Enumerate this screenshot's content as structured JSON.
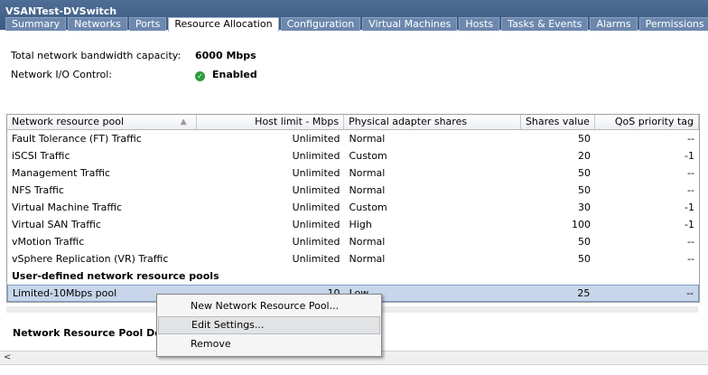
{
  "window": {
    "title": "VSANTest-DVSwitch"
  },
  "tabs": [
    "Summary",
    "Networks",
    "Ports",
    "Resource Allocation",
    "Configuration",
    "Virtual Machines",
    "Hosts",
    "Tasks & Events",
    "Alarms",
    "Permissions"
  ],
  "active_tab": "Resource Allocation",
  "info": {
    "bandwidth_label": "Total network bandwidth capacity:",
    "bandwidth_value": "6000 Mbps",
    "nioc_label": "Network I/O Control:",
    "nioc_value": "Enabled"
  },
  "table": {
    "columns": [
      "Network resource pool",
      "Host limit - Mbps",
      "Physical adapter shares",
      "Shares value",
      "QoS priority tag"
    ],
    "rows": [
      {
        "pool": "Fault Tolerance (FT) Traffic",
        "limit": "Unlimited",
        "shares": "Normal",
        "value": "50",
        "qos": "--"
      },
      {
        "pool": "iSCSI Traffic",
        "limit": "Unlimited",
        "shares": "Custom",
        "value": "20",
        "qos": "-1"
      },
      {
        "pool": "Management Traffic",
        "limit": "Unlimited",
        "shares": "Normal",
        "value": "50",
        "qos": "--"
      },
      {
        "pool": "NFS Traffic",
        "limit": "Unlimited",
        "shares": "Normal",
        "value": "50",
        "qos": "--"
      },
      {
        "pool": "Virtual Machine Traffic",
        "limit": "Unlimited",
        "shares": "Custom",
        "value": "30",
        "qos": "-1"
      },
      {
        "pool": "Virtual SAN Traffic",
        "limit": "Unlimited",
        "shares": "High",
        "value": "100",
        "qos": "-1"
      },
      {
        "pool": "vMotion Traffic",
        "limit": "Unlimited",
        "shares": "Normal",
        "value": "50",
        "qos": "--"
      },
      {
        "pool": "vSphere Replication (VR) Traffic",
        "limit": "Unlimited",
        "shares": "Normal",
        "value": "50",
        "qos": "--"
      }
    ],
    "group_label": "User-defined network resource pools",
    "user_rows": [
      {
        "pool": "Limited-10Mbps pool",
        "limit": "10",
        "shares": "Low",
        "value": "25",
        "qos": "--"
      }
    ]
  },
  "details_title": "Network Resource Pool Details",
  "context_menu": {
    "items": [
      "New Network Resource Pool...",
      "Edit Settings...",
      "Remove"
    ],
    "highlighted": "Edit Settings..."
  }
}
